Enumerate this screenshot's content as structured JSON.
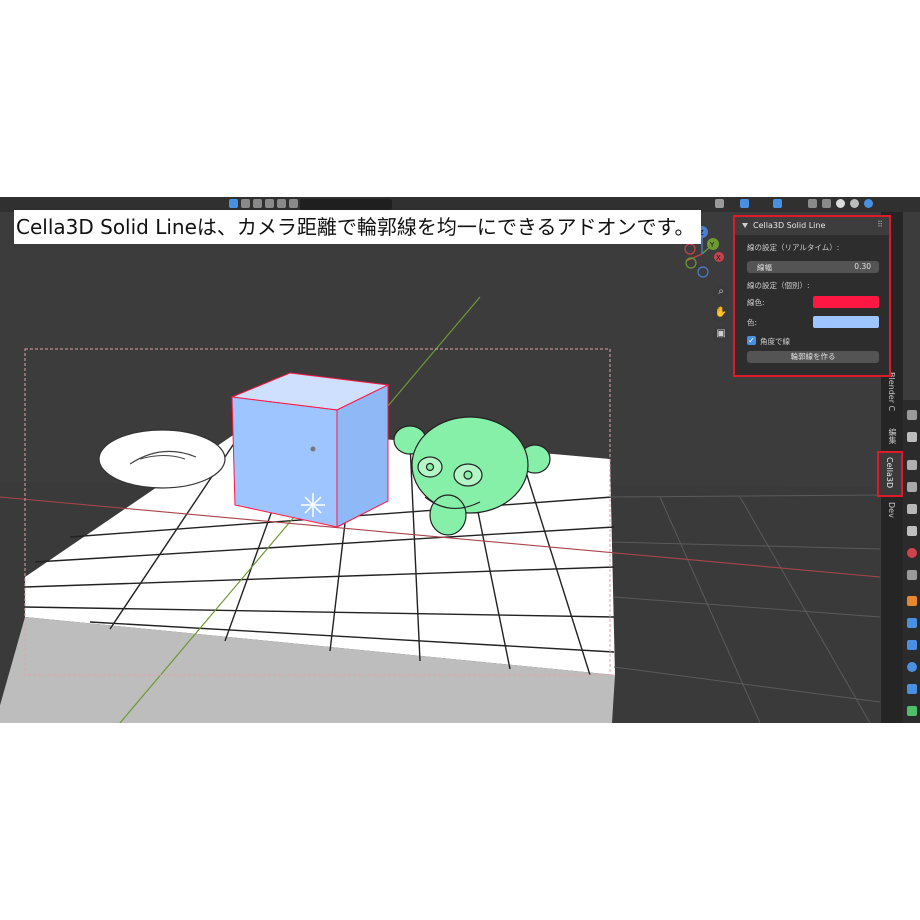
{
  "caption": "Cella3D Solid Lineは、カメラ距離で輪郭線を均一にできるアドオンです。",
  "panel": {
    "title": "Cella3D Solid Line",
    "section_realtime": "線の設定（リアルタイム）:",
    "line_width_label": "線幅",
    "line_width_value": "0.30",
    "section_individual": "線の設定（個別）:",
    "outline_color_label": "線色:",
    "fill_color_label": "色:",
    "outline_color": "#ff1744",
    "fill_color": "#9ec5ff",
    "angle_line_label": "角度で線",
    "create_button": "輪郭線を作る"
  },
  "sidebar_tabs": {
    "tab_blender": "Blender C",
    "tab_item": "編集",
    "tab_cella": "Cella3D",
    "tab_dev": "Dev"
  },
  "gizmo": {
    "x_label": "X",
    "y_label": "Y",
    "z_label": "Z",
    "zoom_icon": "magnifier-icon",
    "pan_icon": "hand-icon",
    "camera_icon": "camera-icon"
  },
  "colors": {
    "cube_fill": "#9ec5ff",
    "monkey_fill": "#86f0a8",
    "outline": "#ff1744",
    "viewport_bg": "#3c3c3c"
  }
}
